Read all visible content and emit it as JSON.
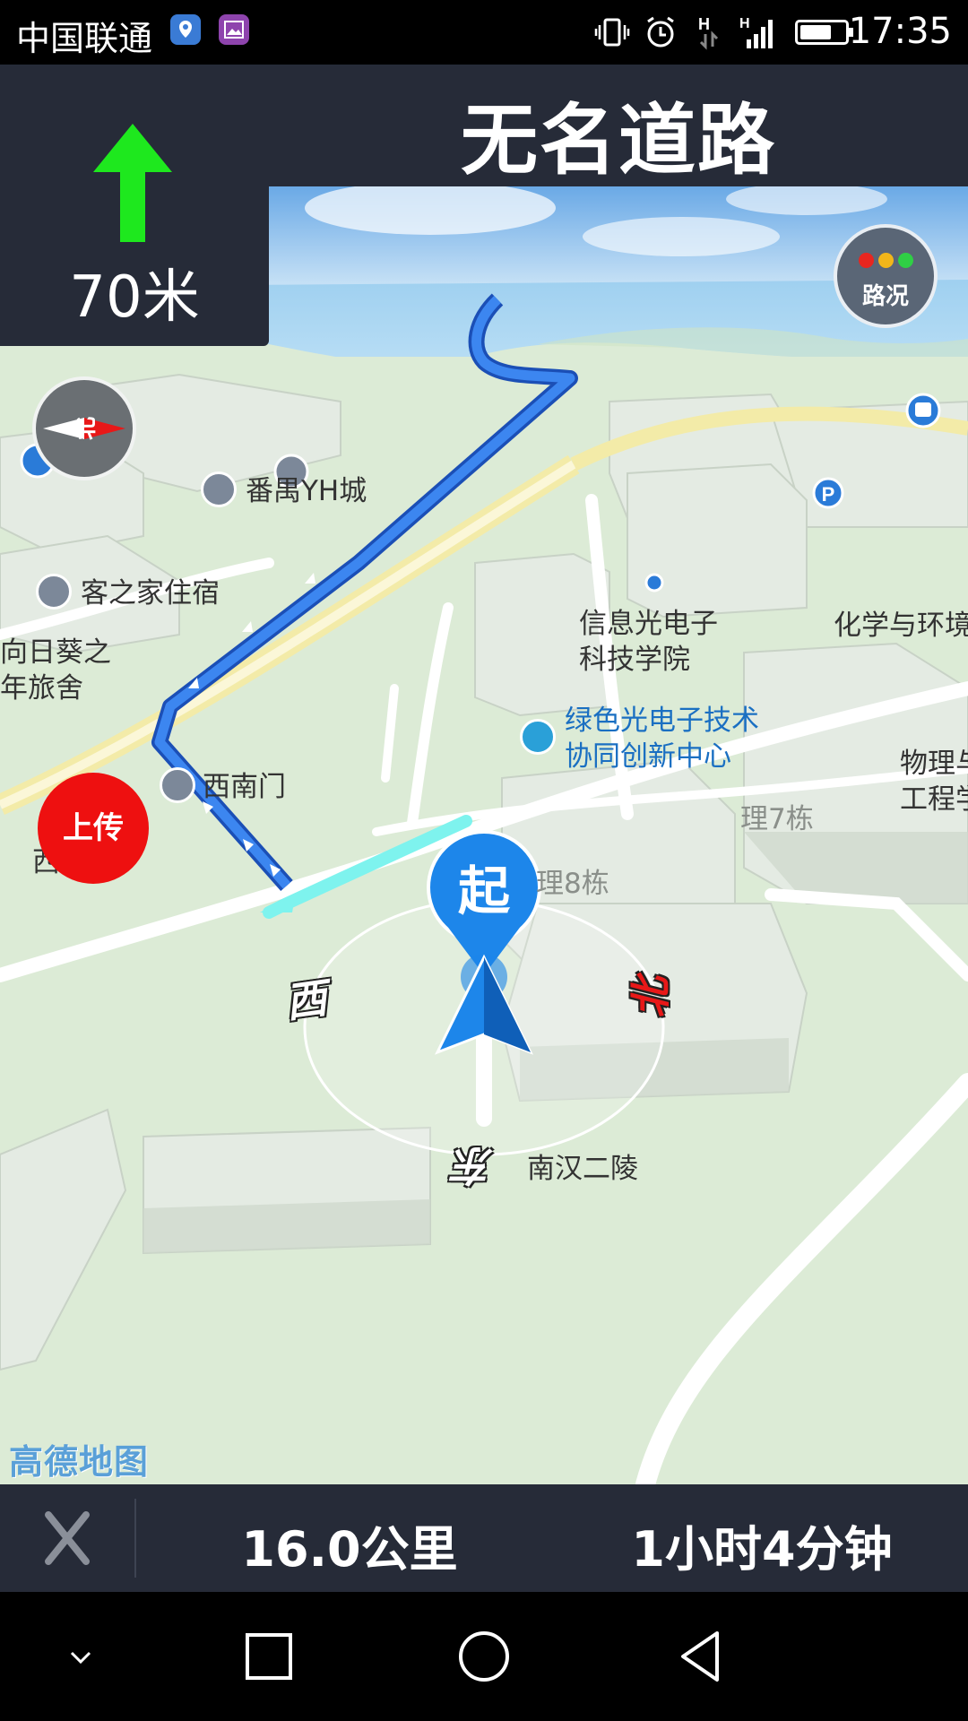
{
  "status_bar": {
    "carrier": "中国联通",
    "time": "17:35",
    "network": "H",
    "battery_level": 0.7,
    "app_icons": [
      "location-app-icon",
      "gallery-app-icon"
    ],
    "status_icons": [
      "vibrate-icon",
      "alarm-icon",
      "data-arrows-icon",
      "signal-icon",
      "battery-icon"
    ]
  },
  "navigation": {
    "road_name": "无名道路",
    "next_turn": {
      "icon": "straight-arrow-icon",
      "distance": "70米"
    },
    "traffic_button_label": "路况",
    "compass_label": "北",
    "upload_button_label": "上传",
    "direction_labels": {
      "west": "西",
      "north": "北",
      "east": "东"
    },
    "start_marker_label": "起"
  },
  "map": {
    "brand": "高德地图",
    "pois": [
      {
        "name": "番禺YH城",
        "icon": "mall-icon"
      },
      {
        "name": "客之家住宿",
        "icon": "hotel-icon"
      },
      {
        "name": "向日葵之\n年旅舍",
        "icon": ""
      },
      {
        "name": "西南门",
        "icon": "gate-icon"
      },
      {
        "name": "西",
        "icon": ""
      },
      {
        "name": "信息光电子\n科技学院",
        "icon": ""
      },
      {
        "name": "绿色光电子技术\n协同创新中心",
        "icon": "lab-icon"
      },
      {
        "name": "化学与环境",
        "icon": ""
      },
      {
        "name": "物理与\n工程学",
        "icon": ""
      },
      {
        "name": "理7栋",
        "icon": ""
      },
      {
        "name": "理8栋",
        "icon": ""
      },
      {
        "name": "南汉二陵",
        "icon": ""
      }
    ]
  },
  "route_info": {
    "total_distance": "16.0公里",
    "eta": "1小时4分钟"
  },
  "colors": {
    "panel": "#262b38",
    "turn_arrow": "#1ee81e",
    "route": "#2a6fe0",
    "upload": "#ee1010",
    "location_marker": "#1d86ea"
  }
}
